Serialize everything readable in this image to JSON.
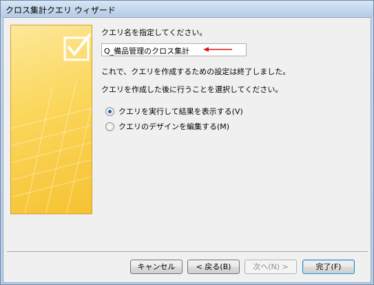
{
  "window": {
    "title": "クロス集計クエリ ウィザード"
  },
  "main": {
    "prompt": "クエリ名を指定してください。",
    "query_name": "Q_備品管理のクロス集計",
    "message1": "これで、クエリを作成するための設定は終了しました。",
    "message2": "クエリを作成した後に行うことを選択してください。",
    "options": [
      {
        "label": "クエリを実行して結果を表示する(V)",
        "selected": true
      },
      {
        "label": "クエリのデザインを編集する(M)",
        "selected": false
      }
    ]
  },
  "buttons": {
    "cancel": "キャンセル",
    "back": "< 戻る(B)",
    "next": "次へ(N) >",
    "finish": "完了(F)"
  },
  "colors": {
    "arrow": "#e0141b",
    "sidebar": "#fbd65a",
    "accent": "#1f5fa9"
  },
  "icons": {
    "sidebar": "checkbox-checked-icon"
  }
}
